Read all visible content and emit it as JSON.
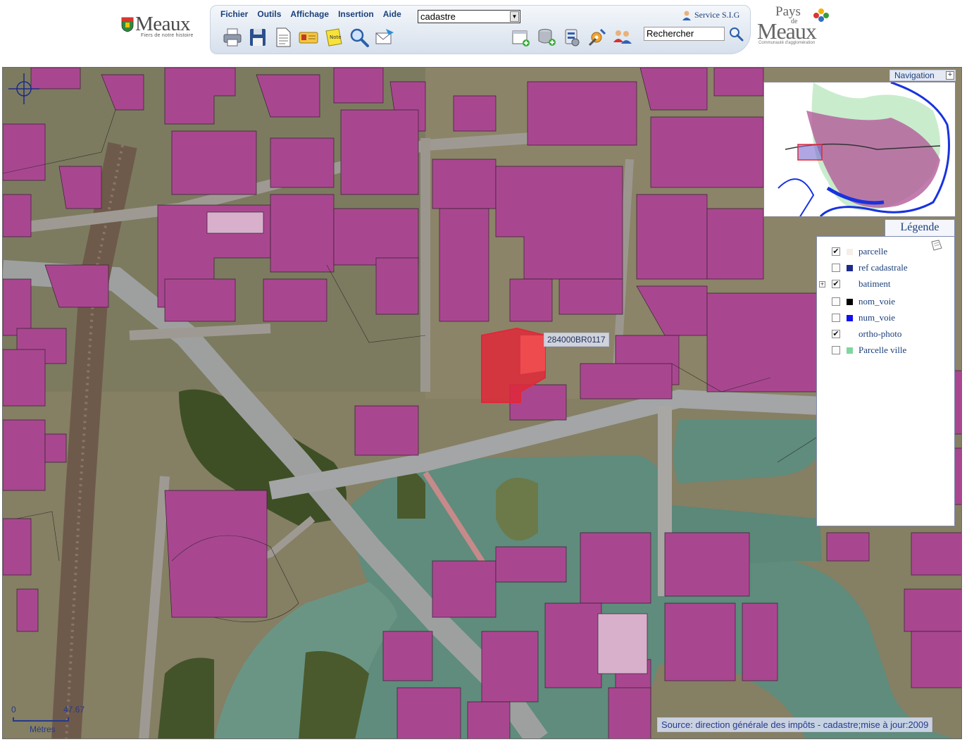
{
  "header": {
    "logo_left": {
      "name": "Meaux",
      "tagline": "Fiers de notre histoire"
    },
    "logo_right": {
      "line1": "Pays",
      "line2": "de",
      "line3": "Meaux",
      "tagline": "Communauté d'agglomération"
    },
    "menu": [
      "Fichier",
      "Outils",
      "Affichage",
      "Insertion",
      "Aide"
    ],
    "layer_select": {
      "value": "cadastre"
    },
    "service": "Service S.I.G",
    "search": {
      "value": "Rechercher"
    },
    "toolbar_icons": [
      "print-icon",
      "save-icon",
      "document-icon",
      "id-card-icon",
      "note-icon",
      "zoom-icon",
      "send-mail-icon"
    ],
    "right_icons": [
      "new-layer-icon",
      "add-database-icon",
      "layers-config-icon",
      "tools-icon",
      "users-icon"
    ]
  },
  "map": {
    "parcel_label": "284000BR0117",
    "navigation_title": "Navigation",
    "legend": {
      "title": "Légende",
      "items": [
        {
          "label": "parcelle",
          "checked": true,
          "swatch": "#f5efe8",
          "expandable": false
        },
        {
          "label": "ref cadastrale",
          "checked": false,
          "swatch": "#1c2a8a",
          "expandable": false
        },
        {
          "label": "batiment",
          "checked": true,
          "swatch": "",
          "expandable": true
        },
        {
          "label": "nom_voie",
          "checked": false,
          "swatch": "#000000",
          "expandable": false
        },
        {
          "label": "num_voie",
          "checked": false,
          "swatch": "#1010ee",
          "expandable": false
        },
        {
          "label": "ortho-photo",
          "checked": true,
          "swatch": "",
          "expandable": false
        },
        {
          "label": "Parcelle ville",
          "checked": false,
          "swatch": "#7fd6a0",
          "expandable": false
        }
      ]
    },
    "scale": {
      "min": "0",
      "max": "47.67",
      "unit": "Mètres"
    },
    "source": "Source: direction générale des impôts - cadastre;mise à jour:2009"
  },
  "colors": {
    "building": "#a8478f",
    "river": "#5f8c7c",
    "highlight": "#e0283a",
    "link": "#1b3f7a"
  }
}
